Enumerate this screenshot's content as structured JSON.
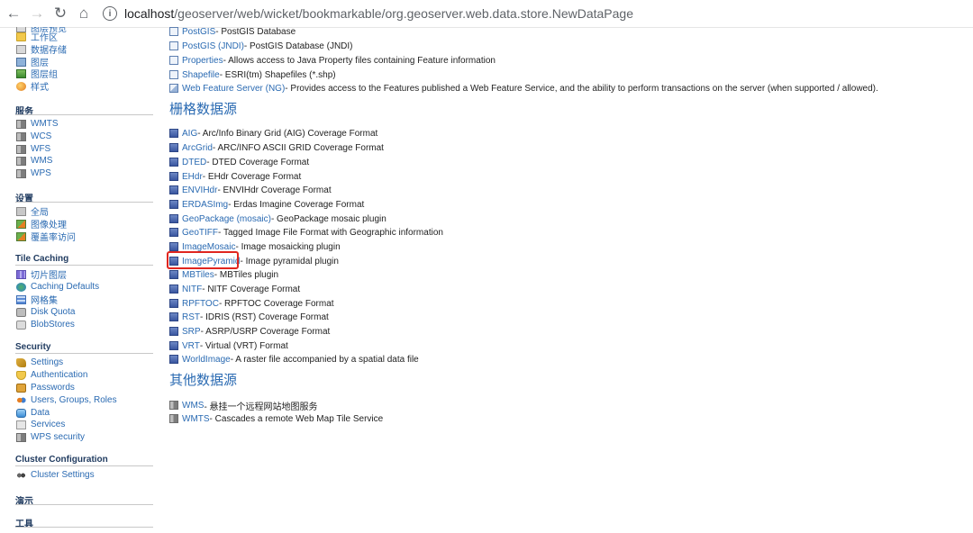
{
  "browser": {
    "url_host": "localhost",
    "url_path": "/geoserver/web/wicket/bookmarkable/org.geoserver.web.data.store.NewDataPage"
  },
  "sidebar": {
    "data_items": [
      {
        "label": "图层预览",
        "icon": "layer-preview-icon"
      },
      {
        "label": "工作区",
        "icon": "folder-icon"
      },
      {
        "label": "数据存储",
        "icon": "store-icon"
      },
      {
        "label": "图层",
        "icon": "layer-icon"
      },
      {
        "label": "图层组",
        "icon": "layer-group-icon"
      },
      {
        "label": "样式",
        "icon": "style-icon"
      }
    ],
    "services": {
      "title": "服务",
      "items": [
        "WMTS",
        "WCS",
        "WFS",
        "WMS",
        "WPS"
      ]
    },
    "settings": {
      "title": "设置",
      "items": [
        "全局",
        "图像处理",
        "覆盖率访问"
      ]
    },
    "tile_caching": {
      "title": "Tile Caching",
      "items": [
        "切片图层",
        "Caching Defaults",
        "网格集",
        "Disk Quota",
        "BlobStores"
      ]
    },
    "security": {
      "title": "Security",
      "items": [
        "Settings",
        "Authentication",
        "Passwords",
        "Users, Groups, Roles",
        "Data",
        "Services",
        "WPS security"
      ]
    },
    "cluster": {
      "title": "Cluster Configuration",
      "items": [
        "Cluster Settings"
      ]
    },
    "demo": {
      "title": "演示"
    },
    "tools": {
      "title": "工具"
    }
  },
  "main": {
    "vector_sources": [
      {
        "name": "PostGIS",
        "desc": " - PostGIS Database"
      },
      {
        "name": "PostGIS (JNDI)",
        "desc": " - PostGIS Database (JNDI)"
      },
      {
        "name": "Properties",
        "desc": " - Allows access to Java Property files containing Feature information"
      },
      {
        "name": "Shapefile",
        "desc": " - ESRI(tm) Shapefiles (*.shp)"
      },
      {
        "name": "Web Feature Server (NG)",
        "desc": " - Provides access to the Features published a Web Feature Service, and the ability to perform transactions on the server (when supported / allowed)."
      }
    ],
    "raster_title": "栅格数据源",
    "raster_sources": [
      {
        "name": "AIG",
        "desc": " - Arc/Info Binary Grid (AIG) Coverage Format"
      },
      {
        "name": "ArcGrid",
        "desc": " - ARC/INFO ASCII GRID Coverage Format"
      },
      {
        "name": "DTED",
        "desc": " - DTED Coverage Format"
      },
      {
        "name": "EHdr",
        "desc": " - EHdr Coverage Format"
      },
      {
        "name": "ENVIHdr",
        "desc": " - ENVIHdr Coverage Format"
      },
      {
        "name": "ERDASImg",
        "desc": " - Erdas Imagine Coverage Format"
      },
      {
        "name": "GeoPackage (mosaic)",
        "desc": " - GeoPackage mosaic plugin"
      },
      {
        "name": "GeoTIFF",
        "desc": " - Tagged Image File Format with Geographic information"
      },
      {
        "name": "ImageMosaic",
        "desc": " - Image mosaicking plugin"
      },
      {
        "name": "ImagePyramid",
        "desc": " - Image pyramidal plugin"
      },
      {
        "name": "MBTiles",
        "desc": " - MBTiles plugin"
      },
      {
        "name": "NITF",
        "desc": " - NITF Coverage Format"
      },
      {
        "name": "RPFTOC",
        "desc": " - RPFTOC Coverage Format"
      },
      {
        "name": "RST",
        "desc": " - IDRIS (RST) Coverage Format"
      },
      {
        "name": "SRP",
        "desc": " - ASRP/USRP Coverage Format"
      },
      {
        "name": "VRT",
        "desc": " - Virtual (VRT) Format"
      },
      {
        "name": "WorldImage",
        "desc": " - A raster file accompanied by a spatial data file"
      }
    ],
    "other_title": "其他数据源",
    "other_sources": [
      {
        "name": "WMS",
        "desc": " - 悬挂一个远程网站地图服务"
      },
      {
        "name": "WMTS",
        "desc": " - Cascades a remote Web Map Tile Service"
      }
    ]
  }
}
